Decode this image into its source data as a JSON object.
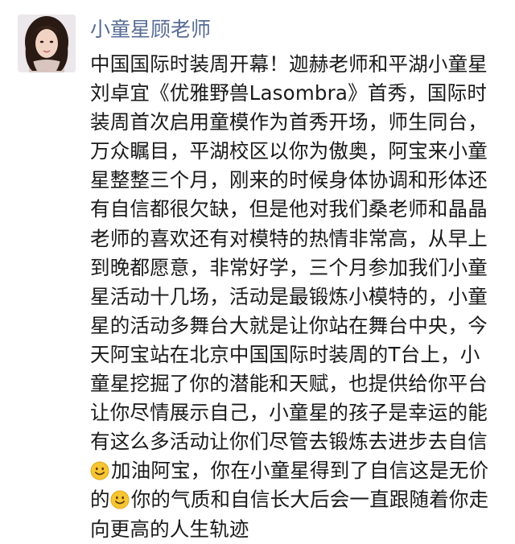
{
  "post": {
    "author_name": "小童星顾老师",
    "content_lines": [
      "中国国际时装周开幕！迦赫老师和平湖小童星",
      "刘卓宜《优雅野兽Lasombra》首秀，国际时",
      "装周首次启用童模作为首秀开场，师生同台，",
      "万众瞩目，平湖校区以你为傲奥，阿宝来小童",
      "星整整三个月，刚来的时候身体协调和形体还",
      "有自信都很欠缺，但是他对我们桑老师和晶晶",
      "老师的喜欢还有对模特的热情非常高，从早上",
      "到晚都愿意，非常好学，三个月参加我们小童",
      "星活动十几场，活动是最锻炼小模特的，小童",
      "星的活动多舞台大就是让你站在舞台中央，今",
      "天阿宝站在北京中国国际时装周的T台上，小",
      "童星挖掘了你的潜能和天赋，也提供给你平台",
      "让你尽情展示自己，小童星的孩子是幸运的能",
      "有这么多活动让你们尽管去锻炼去进步去自信"
    ],
    "line_15": "加油阿宝，你在小童星得到了自信这是无价",
    "line_16_a": "的",
    "line_16_b": "你的气质和自信长大后会一直跟随着你走",
    "line_17": "向更高的人生轨迹",
    "icons": [
      "avatar-photo",
      "smile-emoji-icon",
      "smile-emoji-icon"
    ],
    "colors": {
      "author": "#576b95",
      "text": "#1a1a1a",
      "emoji": "#f7c531"
    }
  }
}
